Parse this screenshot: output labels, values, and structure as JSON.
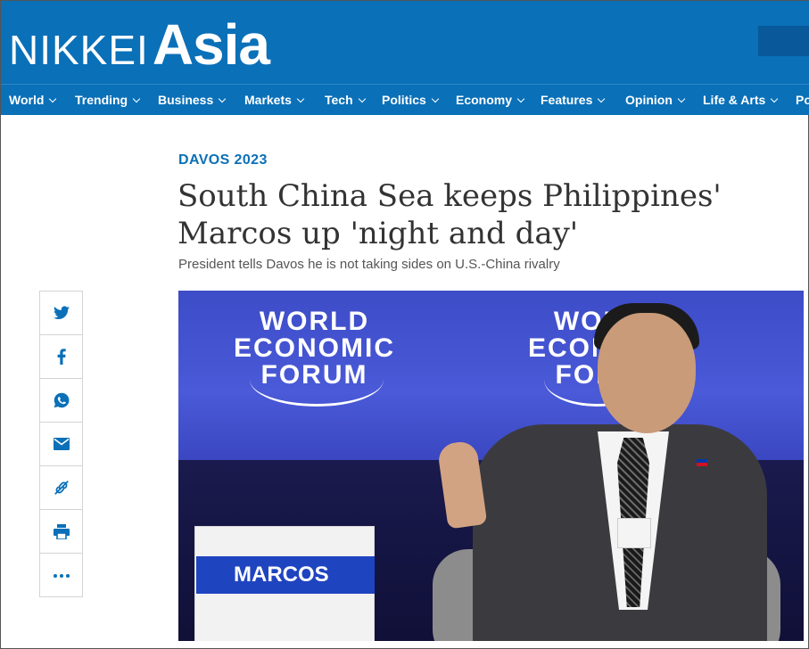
{
  "header": {
    "logo_nikkei": "NIKKEI",
    "logo_asia": "Asia",
    "brand_color": "#0a70b8"
  },
  "nav": {
    "items": [
      {
        "label": "World"
      },
      {
        "label": "Trending"
      },
      {
        "label": "Business"
      },
      {
        "label": "Markets"
      },
      {
        "label": "Tech"
      },
      {
        "label": "Politics"
      },
      {
        "label": "Economy"
      },
      {
        "label": "Features"
      },
      {
        "label": "Opinion"
      },
      {
        "label": "Life & Arts"
      },
      {
        "label": "Po"
      }
    ]
  },
  "article": {
    "kicker": "DAVOS 2023",
    "headline": "South China Sea keeps Philippines' Marcos up 'night and day'",
    "subhead": "President tells Davos he is not taking sides on U.S.-China rivalry"
  },
  "share": {
    "buttons": [
      {
        "icon": "twitter-icon"
      },
      {
        "icon": "facebook-icon"
      },
      {
        "icon": "whatsapp-icon"
      },
      {
        "icon": "email-icon"
      },
      {
        "icon": "copy-link-icon"
      },
      {
        "icon": "print-icon"
      },
      {
        "icon": "more-icon"
      }
    ]
  },
  "hero": {
    "backdrop_text_line1": "WORLD",
    "backdrop_text_line2": "ECONOMIC",
    "backdrop_text_line3": "FORUM",
    "name_plate": "MARCOS"
  }
}
